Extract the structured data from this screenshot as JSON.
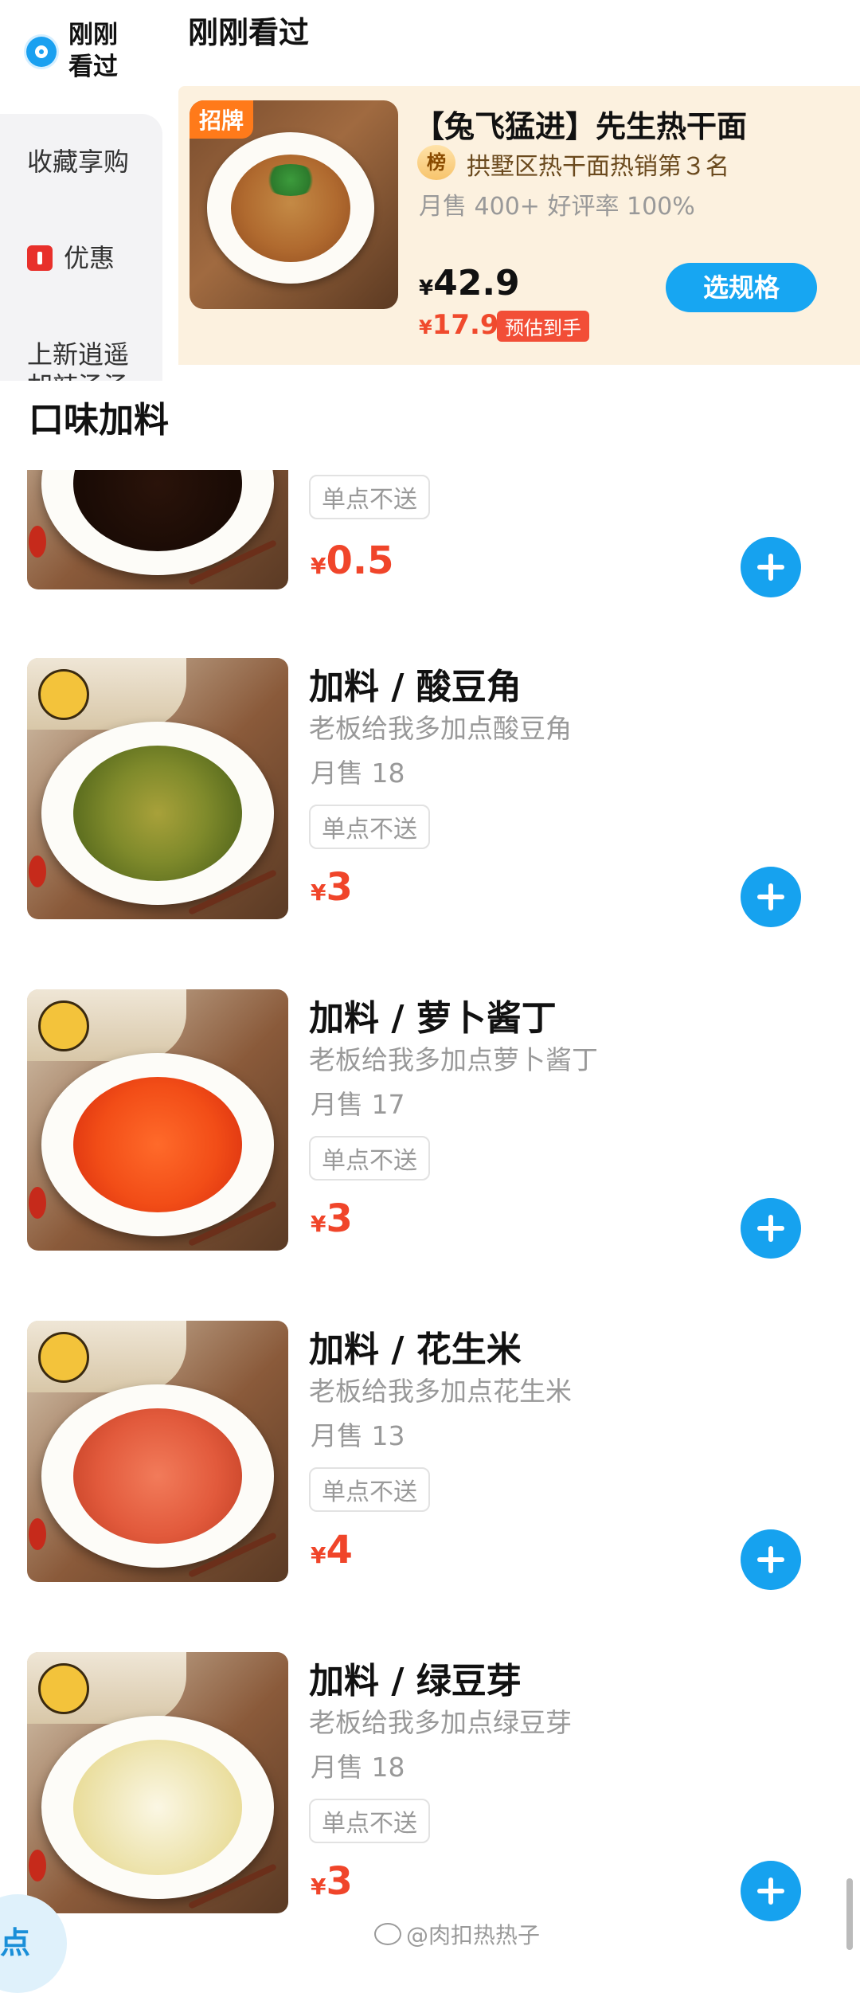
{
  "recently_viewed_tab": {
    "label": "刚刚看过"
  },
  "header": {
    "title": "刚刚看过"
  },
  "sidebar": {
    "items": [
      {
        "label": "收藏享购"
      },
      {
        "label": "优惠"
      },
      {
        "label": "上新逍遥胡辣汤汤"
      }
    ]
  },
  "recent_card": {
    "badge": "招牌",
    "name": "【兔飞猛进】先生热干面",
    "rank_icon": "榜",
    "rank_text": "拱墅区热干面热销第３名",
    "sales": "月售 400+  好评率 100%",
    "currency": "¥",
    "price": "42.9",
    "est_price": "17.9",
    "est_label": "预估到手",
    "spec_button": "选规格"
  },
  "section": {
    "title": "口味加料"
  },
  "products": [
    {
      "title": "",
      "desc": "",
      "sales": "",
      "tag": "单点不送",
      "currency": "¥",
      "price": "0.5"
    },
    {
      "title": "加料 / 酸豆角",
      "desc": "老板给我多加点酸豆角",
      "sales": "月售 18",
      "tag": "单点不送",
      "currency": "¥",
      "price": "3"
    },
    {
      "title": "加料 / 萝卜酱丁",
      "desc": "老板给我多加点萝卜酱丁",
      "sales": "月售 17",
      "tag": "单点不送",
      "currency": "¥",
      "price": "3"
    },
    {
      "title": "加料 / 花生米",
      "desc": "老板给我多加点花生米",
      "sales": "月售 13",
      "tag": "单点不送",
      "currency": "¥",
      "price": "4"
    },
    {
      "title": "加料 / 绿豆芽",
      "desc": "老板给我多加点绿豆芽",
      "sales": "月售 18",
      "tag": "单点不送",
      "currency": "¥",
      "price": "3"
    }
  ],
  "watermark": "@肉扣热热子",
  "corner_bubble": "点",
  "icons": {
    "recent": "eye-icon",
    "coupon": "coupon-icon",
    "rank": "rank-badge-icon",
    "add": "plus-icon"
  },
  "colors": {
    "accent": "#16a2ef",
    "price_red": "#f0452a",
    "badge_orange": "#ff7a1a",
    "card_bg": "#fcf1df"
  }
}
